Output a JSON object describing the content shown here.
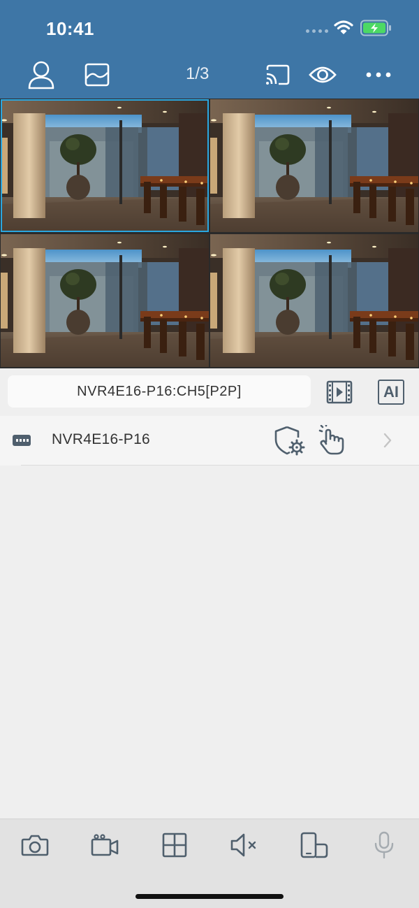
{
  "status_bar": {
    "time": "10:41"
  },
  "toolbar": {
    "page_indicator": "1/3",
    "icons": [
      "person-icon",
      "gallery-icon",
      "cast-icon",
      "eye-icon",
      "more-icon"
    ]
  },
  "camera_grid": {
    "tiles": [
      {
        "name": "camera-tile-1",
        "selected": true
      },
      {
        "name": "camera-tile-2",
        "selected": false
      },
      {
        "name": "camera-tile-3",
        "selected": false
      },
      {
        "name": "camera-tile-4",
        "selected": false
      }
    ]
  },
  "info_bar": {
    "channel_label": "NVR4E16-P16:CH5[P2P]",
    "ai_label": "AI"
  },
  "device_list": {
    "items": [
      {
        "name": "NVR4E16-P16"
      }
    ]
  },
  "bottom_toolbar": {
    "icons": [
      "camera-icon",
      "video-record-icon",
      "grid-icon",
      "mute-icon",
      "devices-icon",
      "microphone-icon"
    ]
  },
  "colors": {
    "header": "#3e76a6",
    "accent": "#2aa7e0",
    "icon_dark": "#4f5f6d"
  }
}
